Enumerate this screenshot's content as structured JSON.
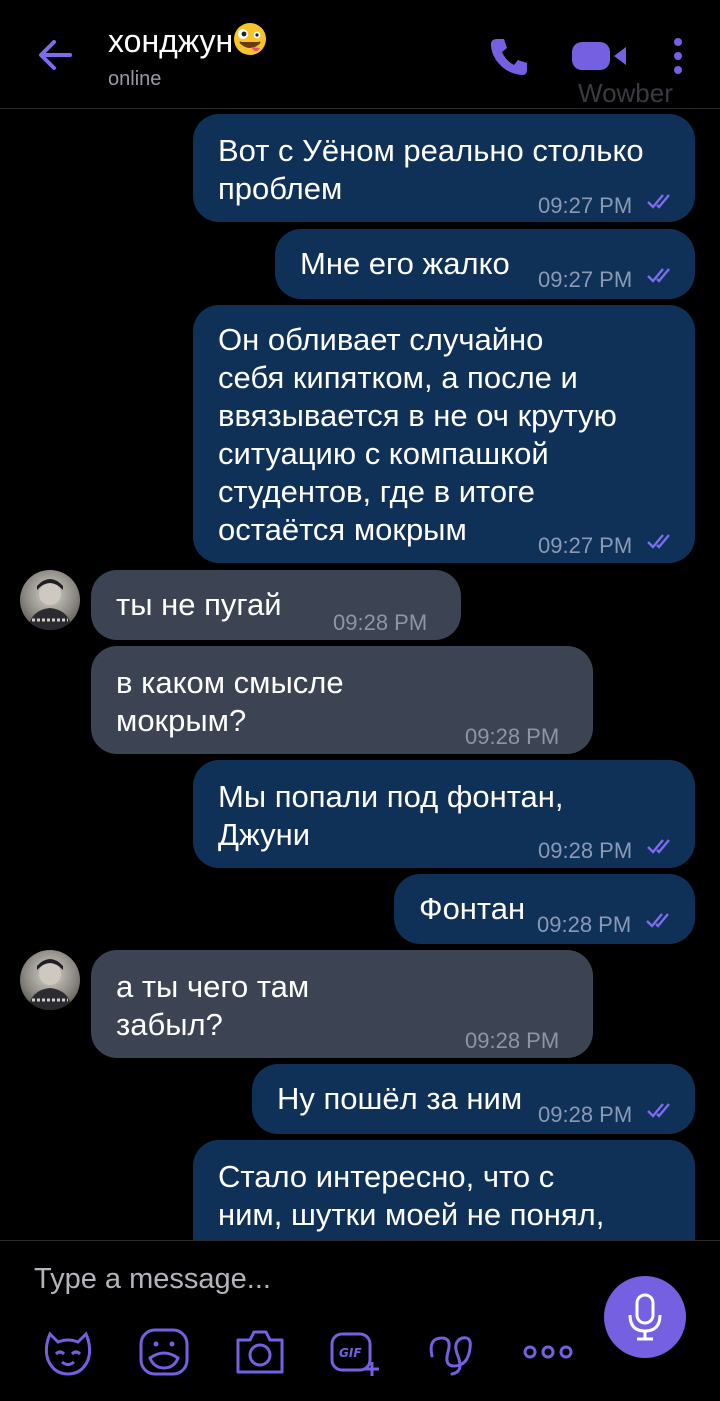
{
  "header": {
    "contact_name": "хонджун",
    "status": "online",
    "watermark": "Wowber",
    "emoji_icon": "zany-face-emoji"
  },
  "messages": [
    {
      "dir": "out",
      "text": "Вот с Уёном реально столько\nпроблем",
      "time": "09:27 PM",
      "read": true
    },
    {
      "dir": "out",
      "text": "Мне его жалко",
      "time": "09:27 PM",
      "read": true
    },
    {
      "dir": "out",
      "text": "Он обливает случайно\nсебя кипятком, а после и\nввязывается в не оч крутую\nситуацию с компашкой\nстудентов, где в итоге\nостаётся мокрым",
      "time": "09:27 PM",
      "read": true
    },
    {
      "dir": "in",
      "text": "ты не пугай",
      "time": "09:28 PM"
    },
    {
      "dir": "in",
      "text": "в каком смысле\nмокрым?",
      "time": "09:28 PM"
    },
    {
      "dir": "out",
      "text": "Мы попали под фонтан,\nДжуни",
      "time": "09:28 PM",
      "read": true
    },
    {
      "dir": "out",
      "text": "Фонтан",
      "time": "09:28 PM",
      "read": true
    },
    {
      "dir": "in",
      "text": "а ты чего там\nзабыл?",
      "time": "09:28 PM"
    },
    {
      "dir": "out",
      "text": "Ну пошёл за ним",
      "time": "09:28 PM",
      "read": true
    },
    {
      "dir": "out",
      "text": "Стало интересно, что с\nним, шутки моей не понял,",
      "time": "",
      "read": false
    }
  ],
  "composer": {
    "placeholder": "Type a message...",
    "tools": [
      "sticker-icon",
      "emoji-face-icon",
      "camera-icon",
      "gif-add-icon",
      "doodle-icon",
      "more-options-icon"
    ],
    "mic_icon": "microphone-icon"
  },
  "colors": {
    "accent": "#7460e0",
    "outgoing_bubble": "#0f3057",
    "incoming_bubble": "#3c4352",
    "read_ticks": "#7b6cf0"
  }
}
